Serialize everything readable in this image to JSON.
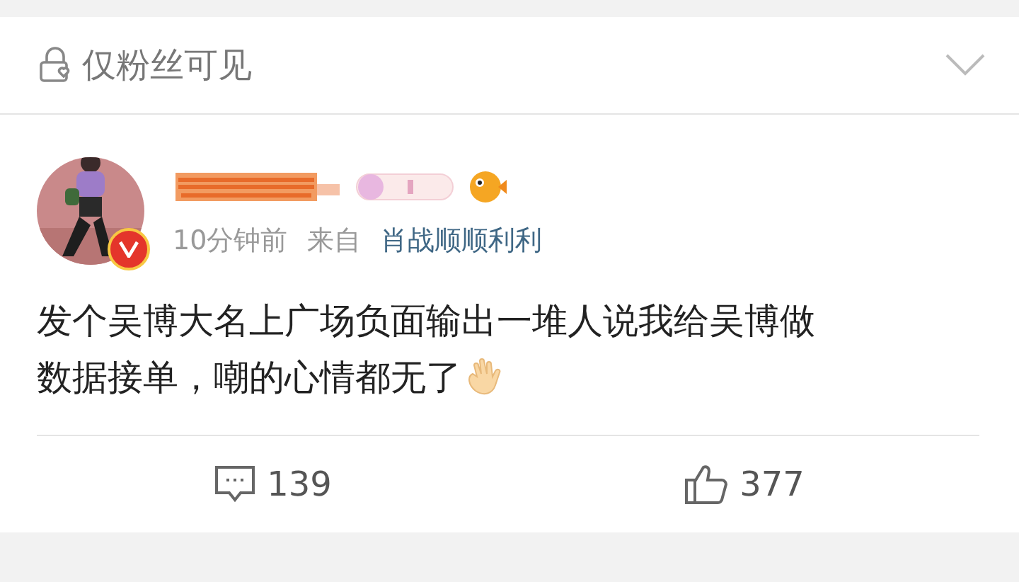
{
  "visibility": {
    "label": "仅粉丝可见"
  },
  "post": {
    "meta": {
      "time": "10分钟前",
      "from_label": "来自",
      "source": "肖战顺顺利利"
    },
    "verified": true,
    "body_lines": [
      "发个吴博大名上广场负面输出一堆人说我给吴博做",
      "数据接单，嘲的心情都无了"
    ],
    "comments": "139",
    "likes": "377"
  }
}
